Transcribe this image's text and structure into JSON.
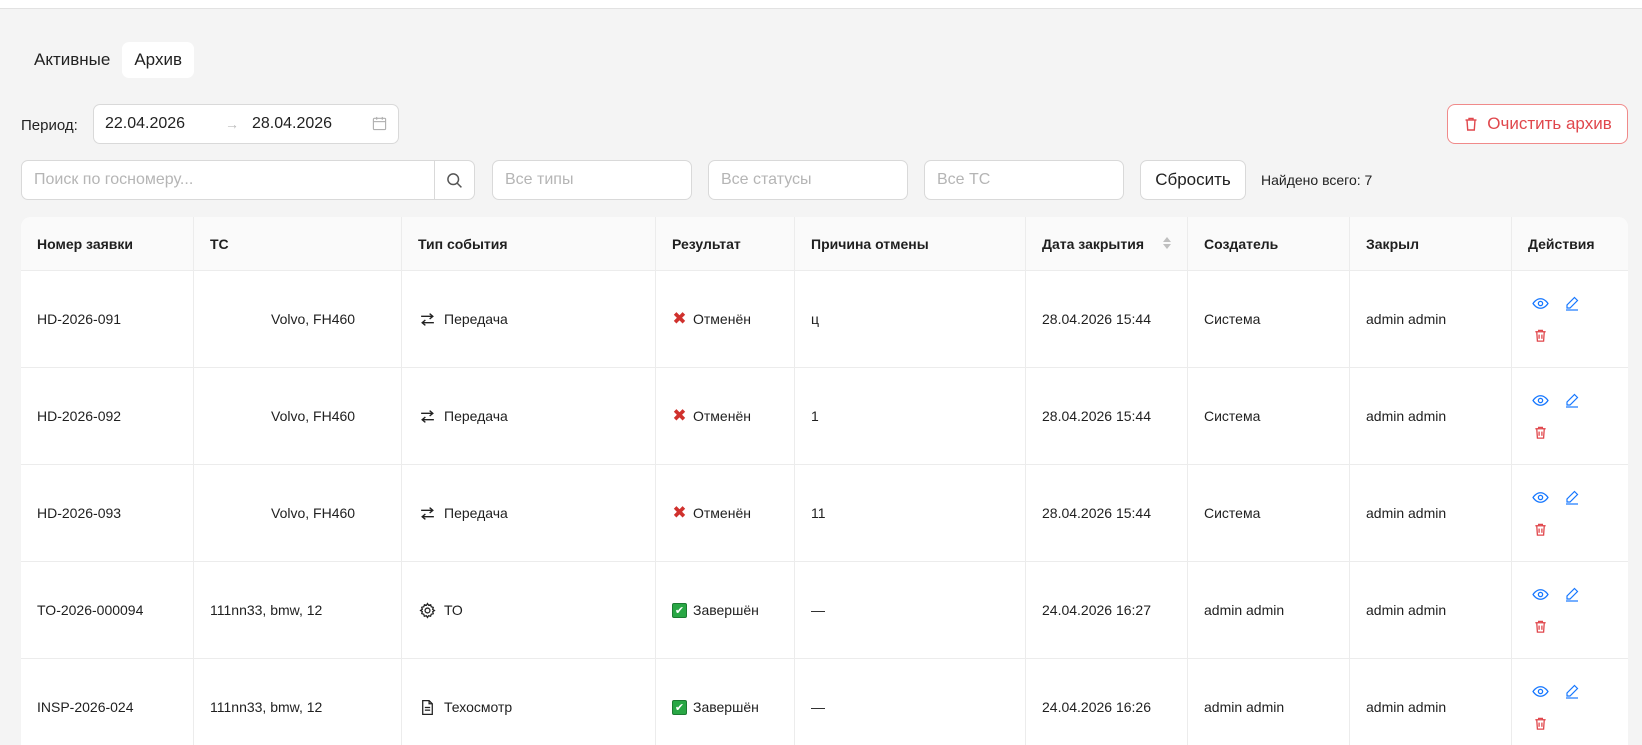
{
  "tabs": [
    {
      "label": "Активные",
      "active": false
    },
    {
      "label": "Архив",
      "active": true
    }
  ],
  "filters": {
    "period_label": "Период:",
    "date_from": "22.04.2026",
    "date_arrow": "→",
    "date_to": "28.04.2026",
    "search_placeholder": "Поиск по госномеру...",
    "types_placeholder": "Все типы",
    "statuses_placeholder": "Все статусы",
    "vehicles_placeholder": "Все ТС",
    "reset_label": "Сбросить",
    "found_text": "Найдено всего: 7"
  },
  "clear_archive_label": "Очистить архив",
  "table": {
    "columns": [
      "Номер заявки",
      "ТС",
      "Тип события",
      "Результат",
      "Причина отмены",
      "Дата закрытия",
      "Создатель",
      "Закрыл",
      "Действия"
    ],
    "rows": [
      {
        "number": "HD-2026-091",
        "vehicle": "Volvo, FH460",
        "event_icon": "transfer-icon",
        "event": "Передача",
        "result_icon": "cancel",
        "result": "Отменён",
        "reason": "ц",
        "closed": "28.04.2026 15:44",
        "creator": "Система",
        "closer": "admin admin"
      },
      {
        "number": "HD-2026-092",
        "vehicle": "Volvo, FH460",
        "event_icon": "transfer-icon",
        "event": "Передача",
        "result_icon": "cancel",
        "result": "Отменён",
        "reason": "1",
        "closed": "28.04.2026 15:44",
        "creator": "Система",
        "closer": "admin admin"
      },
      {
        "number": "HD-2026-093",
        "vehicle": "Volvo, FH460",
        "event_icon": "transfer-icon",
        "event": "Передача",
        "result_icon": "cancel",
        "result": "Отменён",
        "reason": "11",
        "closed": "28.04.2026 15:44",
        "creator": "Система",
        "closer": "admin admin"
      },
      {
        "number": "TO-2026-000094",
        "vehicle": "111nn33, bmw, 12",
        "event_icon": "gear-icon",
        "event": "ТО",
        "result_icon": "done",
        "result": "Завершён",
        "reason": "—",
        "closed": "24.04.2026 16:27",
        "creator": "admin admin",
        "closer": "admin admin"
      },
      {
        "number": "INSP-2026-024",
        "vehicle": "111nn33, bmw, 12",
        "event_icon": "document-icon",
        "event": "Техосмотр",
        "result_icon": "done",
        "result": "Завершён",
        "reason": "—",
        "closed": "24.04.2026 16:26",
        "creator": "admin admin",
        "closer": "admin admin"
      }
    ]
  },
  "colors": {
    "accent": "#1677ff",
    "danger": "#e0474c",
    "cancel_icon": "#d0312d",
    "done_icon": "#29a745"
  }
}
